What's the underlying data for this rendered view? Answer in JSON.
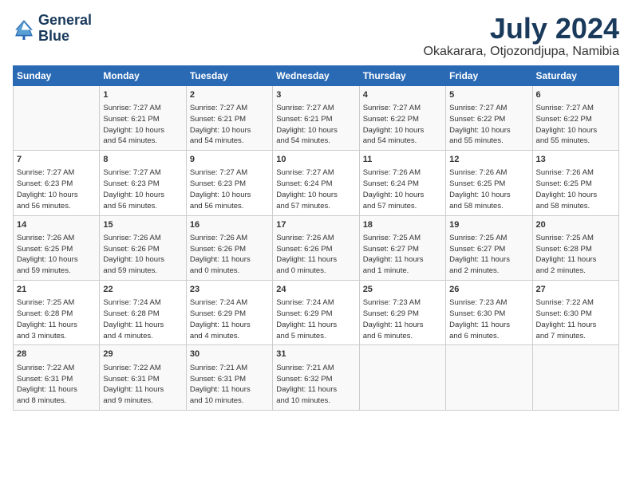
{
  "header": {
    "logo_line1": "General",
    "logo_line2": "Blue",
    "month": "July 2024",
    "location": "Okakarara, Otjozondjupa, Namibia"
  },
  "days_of_week": [
    "Sunday",
    "Monday",
    "Tuesday",
    "Wednesday",
    "Thursday",
    "Friday",
    "Saturday"
  ],
  "weeks": [
    [
      {
        "day": "",
        "info": ""
      },
      {
        "day": "1",
        "info": "Sunrise: 7:27 AM\nSunset: 6:21 PM\nDaylight: 10 hours\nand 54 minutes."
      },
      {
        "day": "2",
        "info": "Sunrise: 7:27 AM\nSunset: 6:21 PM\nDaylight: 10 hours\nand 54 minutes."
      },
      {
        "day": "3",
        "info": "Sunrise: 7:27 AM\nSunset: 6:21 PM\nDaylight: 10 hours\nand 54 minutes."
      },
      {
        "day": "4",
        "info": "Sunrise: 7:27 AM\nSunset: 6:22 PM\nDaylight: 10 hours\nand 54 minutes."
      },
      {
        "day": "5",
        "info": "Sunrise: 7:27 AM\nSunset: 6:22 PM\nDaylight: 10 hours\nand 55 minutes."
      },
      {
        "day": "6",
        "info": "Sunrise: 7:27 AM\nSunset: 6:22 PM\nDaylight: 10 hours\nand 55 minutes."
      }
    ],
    [
      {
        "day": "7",
        "info": "Sunrise: 7:27 AM\nSunset: 6:23 PM\nDaylight: 10 hours\nand 56 minutes."
      },
      {
        "day": "8",
        "info": "Sunrise: 7:27 AM\nSunset: 6:23 PM\nDaylight: 10 hours\nand 56 minutes."
      },
      {
        "day": "9",
        "info": "Sunrise: 7:27 AM\nSunset: 6:23 PM\nDaylight: 10 hours\nand 56 minutes."
      },
      {
        "day": "10",
        "info": "Sunrise: 7:27 AM\nSunset: 6:24 PM\nDaylight: 10 hours\nand 57 minutes."
      },
      {
        "day": "11",
        "info": "Sunrise: 7:26 AM\nSunset: 6:24 PM\nDaylight: 10 hours\nand 57 minutes."
      },
      {
        "day": "12",
        "info": "Sunrise: 7:26 AM\nSunset: 6:25 PM\nDaylight: 10 hours\nand 58 minutes."
      },
      {
        "day": "13",
        "info": "Sunrise: 7:26 AM\nSunset: 6:25 PM\nDaylight: 10 hours\nand 58 minutes."
      }
    ],
    [
      {
        "day": "14",
        "info": "Sunrise: 7:26 AM\nSunset: 6:25 PM\nDaylight: 10 hours\nand 59 minutes."
      },
      {
        "day": "15",
        "info": "Sunrise: 7:26 AM\nSunset: 6:26 PM\nDaylight: 10 hours\nand 59 minutes."
      },
      {
        "day": "16",
        "info": "Sunrise: 7:26 AM\nSunset: 6:26 PM\nDaylight: 11 hours\nand 0 minutes."
      },
      {
        "day": "17",
        "info": "Sunrise: 7:26 AM\nSunset: 6:26 PM\nDaylight: 11 hours\nand 0 minutes."
      },
      {
        "day": "18",
        "info": "Sunrise: 7:25 AM\nSunset: 6:27 PM\nDaylight: 11 hours\nand 1 minute."
      },
      {
        "day": "19",
        "info": "Sunrise: 7:25 AM\nSunset: 6:27 PM\nDaylight: 11 hours\nand 2 minutes."
      },
      {
        "day": "20",
        "info": "Sunrise: 7:25 AM\nSunset: 6:28 PM\nDaylight: 11 hours\nand 2 minutes."
      }
    ],
    [
      {
        "day": "21",
        "info": "Sunrise: 7:25 AM\nSunset: 6:28 PM\nDaylight: 11 hours\nand 3 minutes."
      },
      {
        "day": "22",
        "info": "Sunrise: 7:24 AM\nSunset: 6:28 PM\nDaylight: 11 hours\nand 4 minutes."
      },
      {
        "day": "23",
        "info": "Sunrise: 7:24 AM\nSunset: 6:29 PM\nDaylight: 11 hours\nand 4 minutes."
      },
      {
        "day": "24",
        "info": "Sunrise: 7:24 AM\nSunset: 6:29 PM\nDaylight: 11 hours\nand 5 minutes."
      },
      {
        "day": "25",
        "info": "Sunrise: 7:23 AM\nSunset: 6:29 PM\nDaylight: 11 hours\nand 6 minutes."
      },
      {
        "day": "26",
        "info": "Sunrise: 7:23 AM\nSunset: 6:30 PM\nDaylight: 11 hours\nand 6 minutes."
      },
      {
        "day": "27",
        "info": "Sunrise: 7:22 AM\nSunset: 6:30 PM\nDaylight: 11 hours\nand 7 minutes."
      }
    ],
    [
      {
        "day": "28",
        "info": "Sunrise: 7:22 AM\nSunset: 6:31 PM\nDaylight: 11 hours\nand 8 minutes."
      },
      {
        "day": "29",
        "info": "Sunrise: 7:22 AM\nSunset: 6:31 PM\nDaylight: 11 hours\nand 9 minutes."
      },
      {
        "day": "30",
        "info": "Sunrise: 7:21 AM\nSunset: 6:31 PM\nDaylight: 11 hours\nand 10 minutes."
      },
      {
        "day": "31",
        "info": "Sunrise: 7:21 AM\nSunset: 6:32 PM\nDaylight: 11 hours\nand 10 minutes."
      },
      {
        "day": "",
        "info": ""
      },
      {
        "day": "",
        "info": ""
      },
      {
        "day": "",
        "info": ""
      }
    ]
  ]
}
